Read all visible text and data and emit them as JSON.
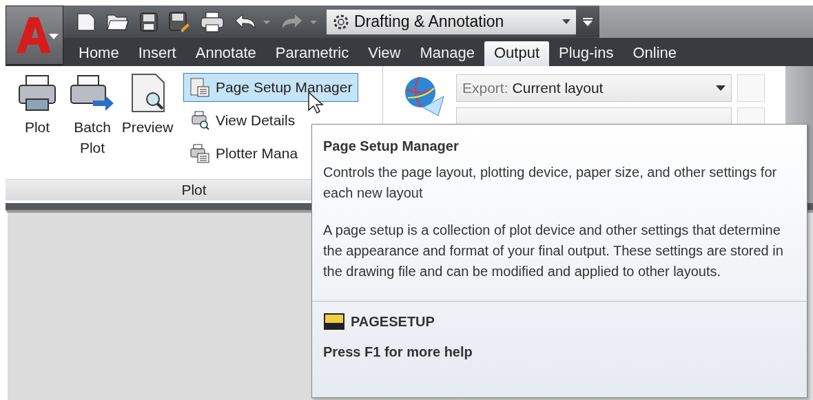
{
  "workspace": {
    "value": "Drafting & Annotation"
  },
  "tabs": [
    {
      "label": "Home",
      "selected": false
    },
    {
      "label": "Insert",
      "selected": false
    },
    {
      "label": "Annotate",
      "selected": false
    },
    {
      "label": "Parametric",
      "selected": false
    },
    {
      "label": "View",
      "selected": false
    },
    {
      "label": "Manage",
      "selected": false
    },
    {
      "label": "Output",
      "selected": true
    },
    {
      "label": "Plug-ins",
      "selected": false
    },
    {
      "label": "Online",
      "selected": false
    }
  ],
  "plot_panel": {
    "title": "Plot",
    "large_buttons": [
      {
        "kind": "plot",
        "label": "Plot"
      },
      {
        "kind": "batch",
        "label": "Batch Plot"
      },
      {
        "kind": "preview",
        "label": "Preview"
      }
    ],
    "small_buttons": [
      {
        "kind": "pagesetup",
        "label": "Page Setup Manager",
        "selected": true
      },
      {
        "kind": "details",
        "label": "View Details",
        "selected": false
      },
      {
        "kind": "plotter",
        "label": "Plotter Mana",
        "selected": false
      }
    ]
  },
  "export_panel": {
    "export": {
      "prefix": "Export:",
      "value": "Current layout"
    }
  },
  "tooltip": {
    "title": "Page Setup Manager",
    "description": "Controls the page layout, plotting device, paper size, and other settings for each new layout",
    "details": "A page setup is a collection of plot device and other settings that determine the appearance and format of your final output. These settings are stored in the drawing file and can be modified and applied to other layouts.",
    "command": "PAGESETUP",
    "help": "Press F1 for more help"
  }
}
